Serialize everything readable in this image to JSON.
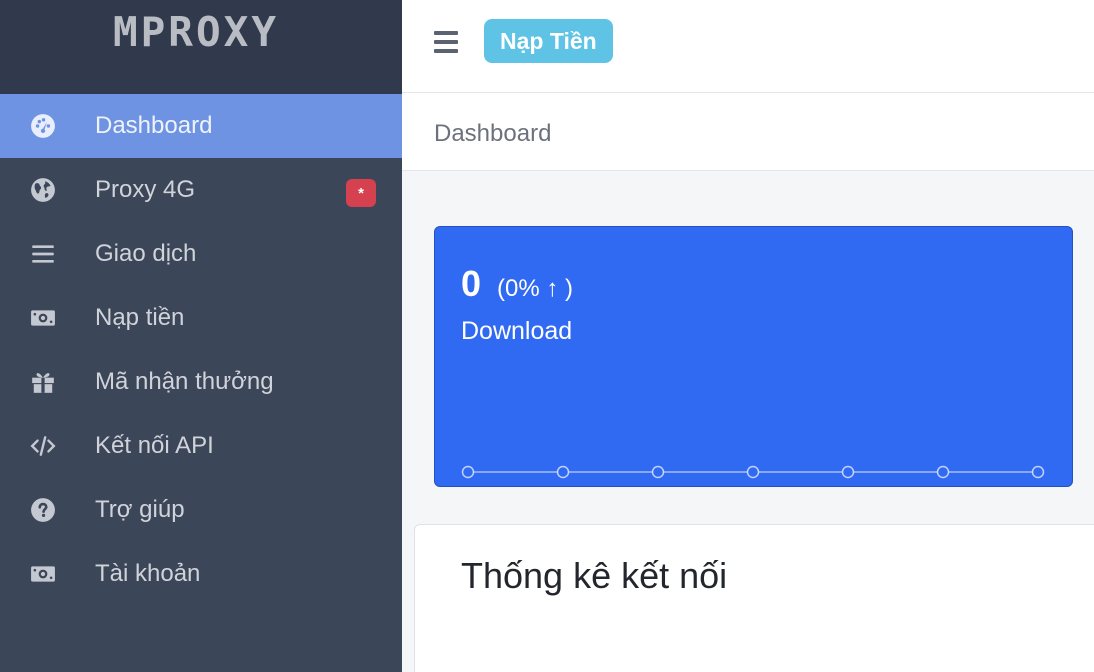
{
  "brand": {
    "logo": "MPROXY"
  },
  "sidebar": {
    "items": [
      {
        "label": "Dashboard",
        "icon": "dashboard-gauge-icon",
        "active": true
      },
      {
        "label": "Proxy 4G",
        "icon": "globe-icon",
        "badge": "*"
      },
      {
        "label": "Giao dịch",
        "icon": "list-icon"
      },
      {
        "label": "Nạp tiền",
        "icon": "money-bill-icon"
      },
      {
        "label": "Mã nhận thưởng",
        "icon": "gift-icon"
      },
      {
        "label": "Kết nối API",
        "icon": "code-icon"
      },
      {
        "label": "Trợ giúp",
        "icon": "question-circle-icon"
      },
      {
        "label": "Tài khoản",
        "icon": "money-bill-icon"
      }
    ]
  },
  "topbar": {
    "menu_icon": "hamburger-icon",
    "topup_label": "Nạp Tiền"
  },
  "breadcrumb": {
    "current": "Dashboard"
  },
  "stat_card": {
    "value": "0",
    "change": "(0% ↑ )",
    "label": "Download",
    "color": "#316af2"
  },
  "stats_panel": {
    "title": "Thống kê kết nối"
  },
  "colors": {
    "sidebar": "#3c4659",
    "sidebar_active": "#6f93e3",
    "badge": "#d6414f",
    "topup_button": "#5ec3e4"
  }
}
